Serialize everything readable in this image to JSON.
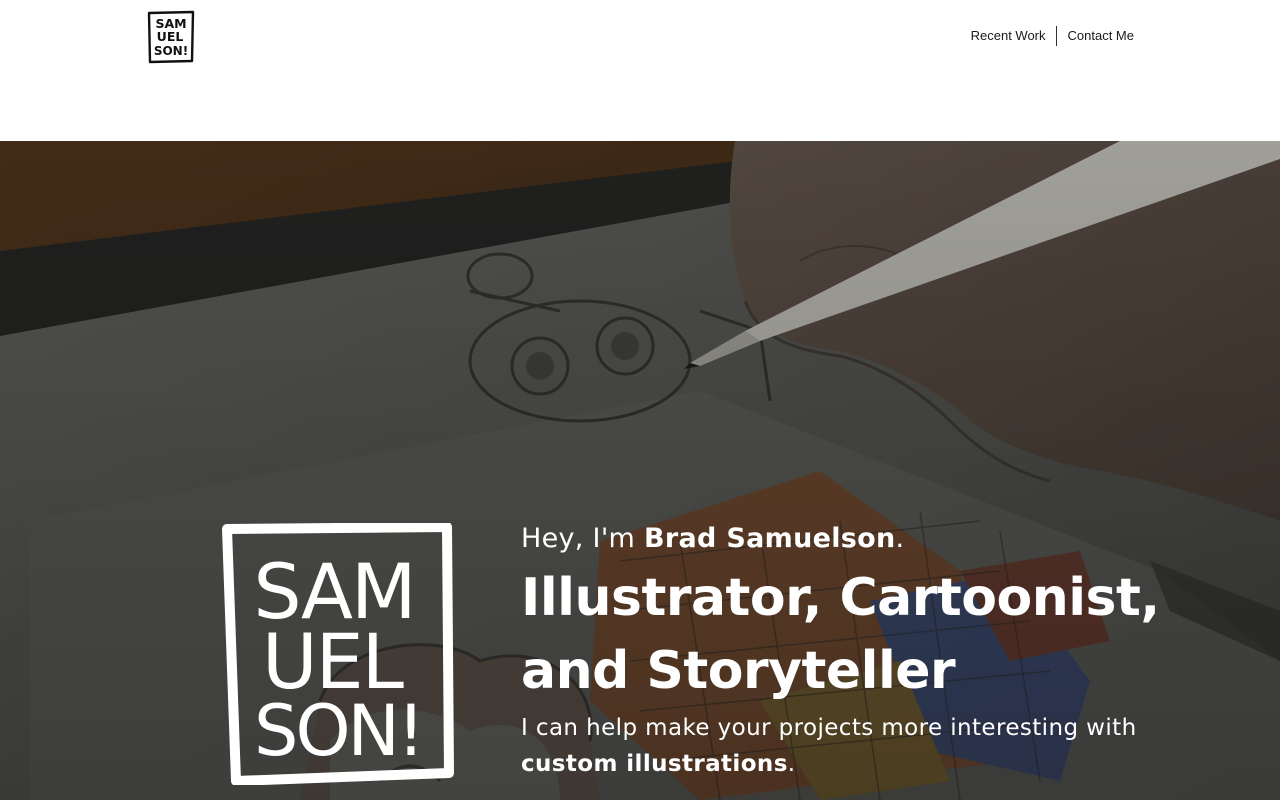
{
  "header": {
    "logo_text": [
      "SAM",
      "UEL",
      "SON!"
    ],
    "nav": [
      {
        "label": "Recent Work"
      },
      {
        "label": "Contact Me"
      }
    ]
  },
  "hero": {
    "logo_text": [
      "SAM",
      "UEL",
      "SON!"
    ],
    "greeting_prefix": "Hey, I'm ",
    "greeting_name": "Brad Samuelson",
    "greeting_suffix": ".",
    "headline_line1": "Illustrator, Cartoonist,",
    "headline_line2": "and Storyteller",
    "tagline_prefix": "I can help make your projects more interesting with ",
    "tagline_bold": "custom illustrations",
    "tagline_suffix": "."
  },
  "colors": {
    "text_dark": "#1a1a1a",
    "hero_text": "#ffffff",
    "hero_overlay": "#3a3a3a"
  }
}
